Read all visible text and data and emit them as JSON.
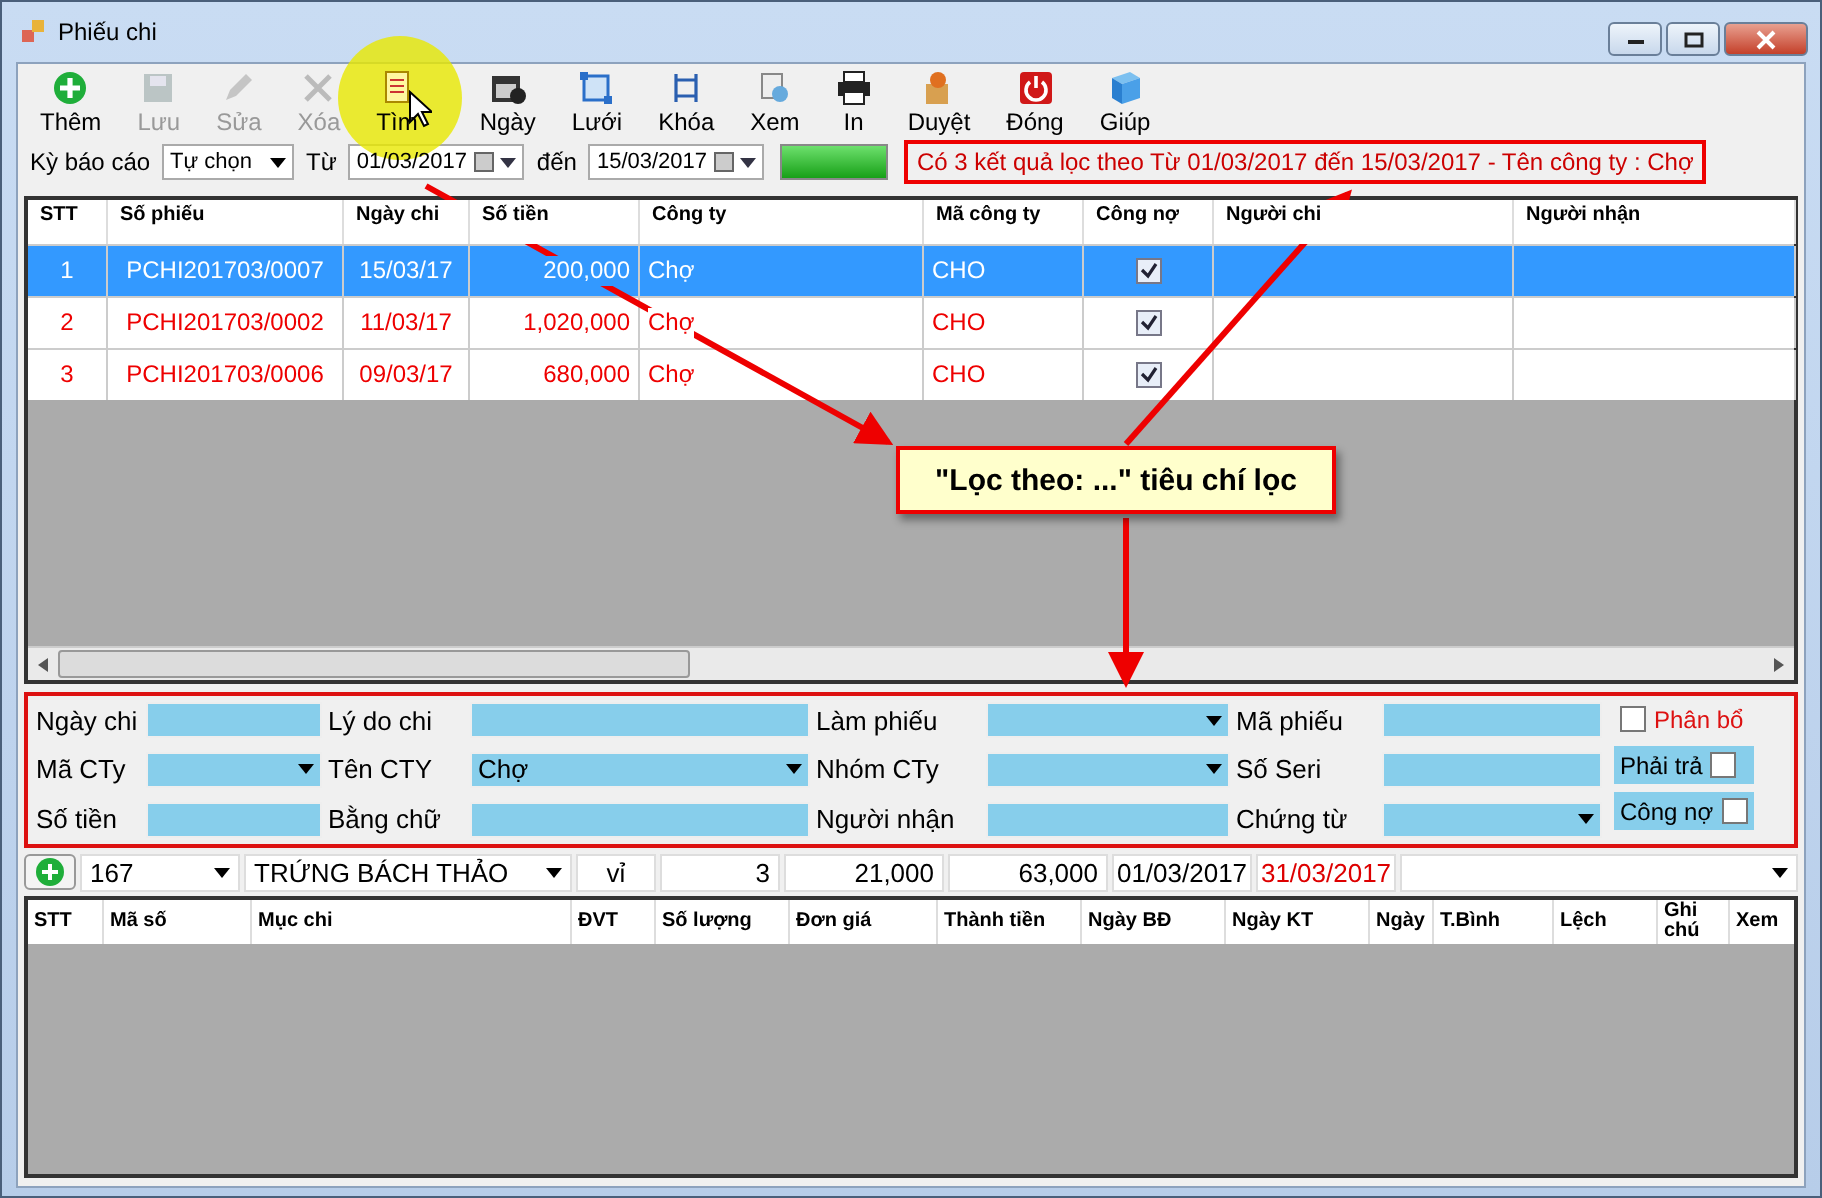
{
  "window": {
    "title": "Phiếu chi"
  },
  "toolbar": [
    {
      "kind": "add",
      "label": "Thêm",
      "disabled": false
    },
    {
      "kind": "save",
      "label": "Lưu",
      "disabled": true
    },
    {
      "kind": "edit",
      "label": "Sửa",
      "disabled": true
    },
    {
      "kind": "delete",
      "label": "Xóa",
      "disabled": true
    },
    {
      "kind": "find",
      "label": "Tìm",
      "disabled": false
    },
    {
      "kind": "calendar",
      "label": "Ngày",
      "disabled": false
    },
    {
      "kind": "grid",
      "label": "Lưới",
      "disabled": false
    },
    {
      "kind": "lock",
      "label": "Khóa",
      "disabled": false
    },
    {
      "kind": "view",
      "label": "Xem",
      "disabled": false
    },
    {
      "kind": "print",
      "label": "In",
      "disabled": false
    },
    {
      "kind": "approve",
      "label": "Duyệt",
      "disabled": false
    },
    {
      "kind": "close",
      "label": "Đóng",
      "disabled": false
    },
    {
      "kind": "help",
      "label": "Giúp",
      "disabled": false
    }
  ],
  "filter": {
    "period_label": "Kỳ báo cáo",
    "period": "Tự chọn",
    "from_label": "Từ",
    "from": "01/03/2017",
    "to_label": "đến",
    "to": "15/03/2017",
    "progress": {
      "level": 1
    },
    "message": "Có 3 kết quả lọc theo Từ 01/03/2017 đến 15/03/2017 - Tên công ty : Chợ"
  },
  "table": {
    "columns": [
      "STT",
      "Số phiếu",
      "Ngày chi",
      "Số tiền",
      "Công ty",
      "Mã công ty",
      "Công nợ",
      "Người chi",
      "Người nhận"
    ],
    "rows": [
      {
        "stt": "1",
        "so_phieu": "PCHI201703/0007",
        "ngay_chi": "15/03/17",
        "so_tien": "200,000",
        "cong_ty": "Chợ",
        "ma_cong_ty": "CHO",
        "cong_no": true,
        "selected": true
      },
      {
        "stt": "2",
        "so_phieu": "PCHI201703/0002",
        "ngay_chi": "11/03/17",
        "so_tien": "1,020,000",
        "cong_ty": "Chợ",
        "ma_cong_ty": "CHO",
        "cong_no": true,
        "selected": false
      },
      {
        "stt": "3",
        "so_phieu": "PCHI201703/0006",
        "ngay_chi": "09/03/17",
        "so_tien": "680,000",
        "cong_ty": "Chợ",
        "ma_cong_ty": "CHO",
        "cong_no": true,
        "selected": false
      }
    ]
  },
  "form": {
    "fields": [
      {
        "label": "Ngày chi",
        "kind": "text"
      },
      {
        "label": "Lý do chi",
        "kind": "text"
      },
      {
        "label": "Làm phiếu",
        "kind": "combo"
      },
      {
        "label": "Mã phiếu",
        "kind": "text"
      },
      {
        "label": "Mã CTy",
        "kind": "combo"
      },
      {
        "label": "Tên CTY",
        "kind": "combo",
        "value": "Chợ"
      },
      {
        "label": "Nhóm CTy",
        "kind": "combo"
      },
      {
        "label": "Số Seri",
        "kind": "text"
      },
      {
        "label": "Số tiền",
        "kind": "text"
      },
      {
        "label": "Bằng chữ",
        "kind": "text"
      },
      {
        "label": "Người nhận",
        "kind": "text"
      },
      {
        "label": "Chứng từ",
        "kind": "combo"
      }
    ],
    "checks": [
      {
        "label": "Phân bổ",
        "kind": "box-first",
        "checked": false
      },
      {
        "label": "Phải trả",
        "kind": "label-first",
        "checked": false
      },
      {
        "label": "Công nợ",
        "kind": "label-first",
        "checked": false
      }
    ]
  },
  "detail_entry": [
    {
      "kind": "combo",
      "value": "167"
    },
    {
      "kind": "combo",
      "value": "TRỨNG BÁCH THẢO"
    },
    {
      "kind": "center",
      "value": "vỉ"
    },
    {
      "kind": "number",
      "value": "3"
    },
    {
      "kind": "number",
      "value": "21,000"
    },
    {
      "kind": "number",
      "value": "63,000"
    },
    {
      "kind": "date",
      "value": "01/03/2017"
    },
    {
      "kind": "date-red",
      "value": "31/03/2017"
    },
    {
      "kind": "combo-empty"
    }
  ],
  "detail_table": {
    "columns": [
      "STT",
      "Mã số",
      "Mục chi",
      "ĐVT",
      "Số lượng",
      "Đơn giá",
      "Thành tiền",
      "Ngày BĐ",
      "Ngày KT",
      "Ngày",
      "T.Bình",
      "Lệch",
      "Ghi chú",
      "Xem"
    ]
  },
  "callout": {
    "text": "\"Lọc theo: ...\" tiêu chí lọc"
  }
}
